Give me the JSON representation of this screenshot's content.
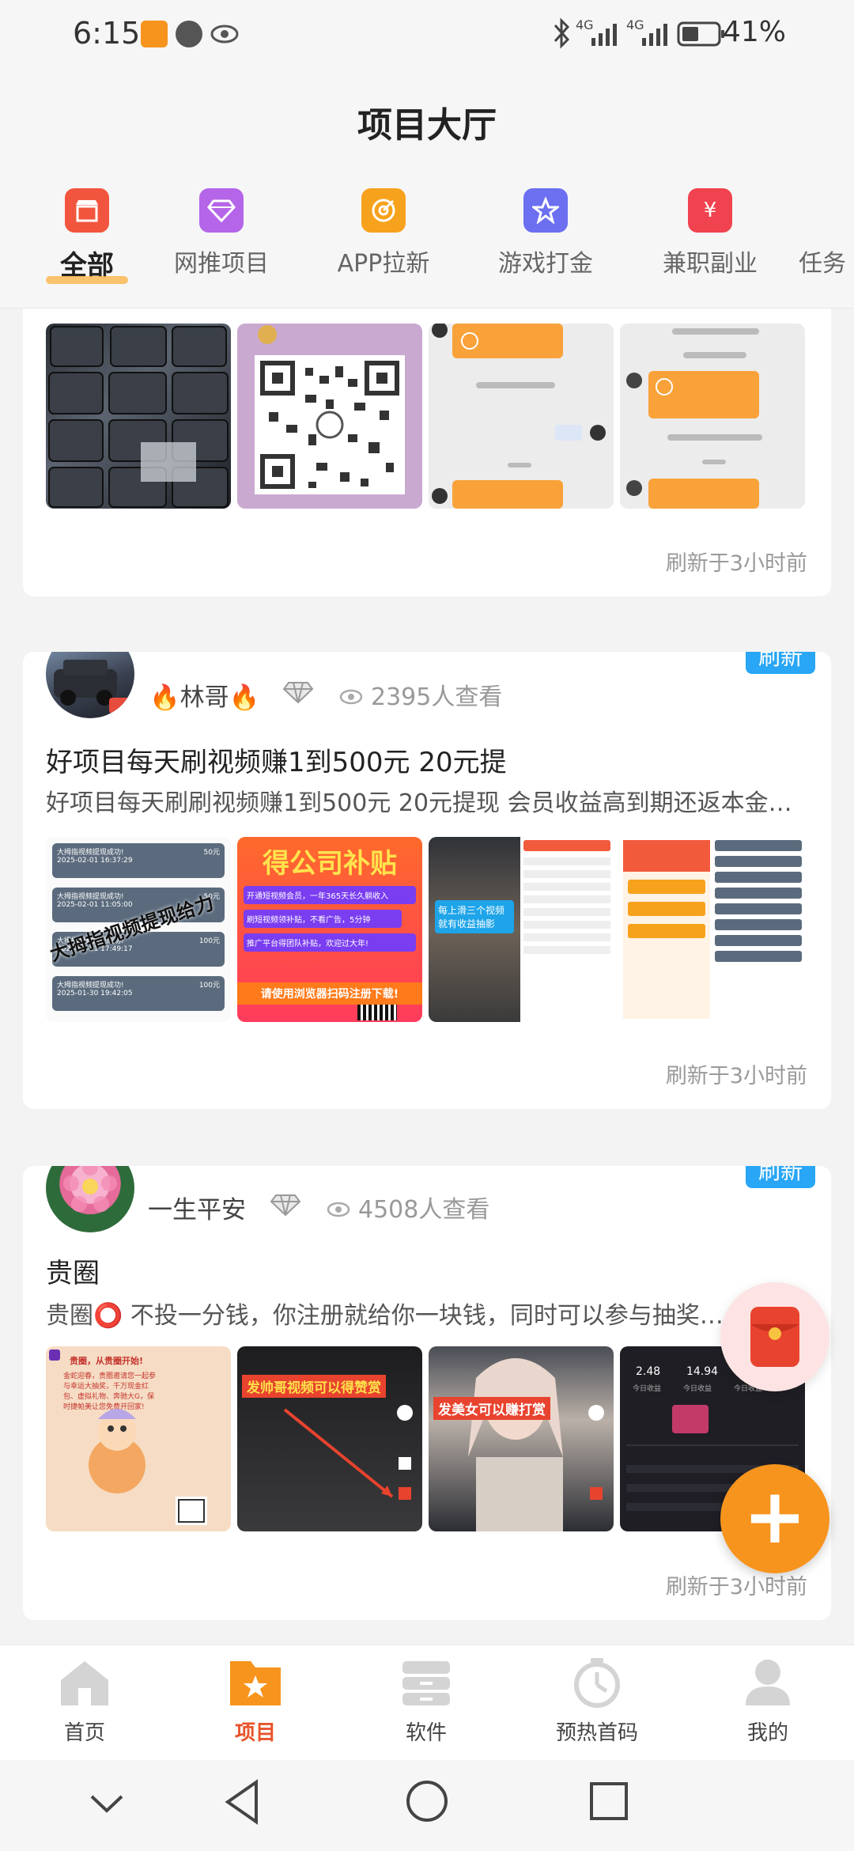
{
  "status_bar": {
    "time": "6:15",
    "network_a": "4G",
    "network_b": "4G",
    "battery": "41%"
  },
  "header": {
    "title": "项目大厅"
  },
  "categories": [
    {
      "label": "全部",
      "icon": "store-icon",
      "color": "#f2553d"
    },
    {
      "label": "网推项目",
      "icon": "diamond-icon",
      "color": "#b565e8"
    },
    {
      "label": "APP拉新",
      "icon": "target-icon",
      "color": "#f7a21c"
    },
    {
      "label": "游戏打金",
      "icon": "star-icon",
      "color": "#6b6ff0"
    },
    {
      "label": "兼职副业",
      "icon": "money-bag-icon",
      "color": "#f0434f"
    },
    {
      "label": "任务",
      "icon": "task-icon",
      "color": "#f7a21c"
    }
  ],
  "cards": [
    {
      "refresh_time": "刷新于3小时前"
    },
    {
      "user": "🔥林哥🔥",
      "views": "2395人查看",
      "badge": "刷新",
      "title": "好项目每天刷视频赚1到500元 20元提",
      "desc": "好项目每天刷刷视频赚1到500元 20元提现 会员收益高到期还返本金…",
      "refresh_time": "刷新于3小时前",
      "thumb_texts": {
        "t1_overlay": "大拇指视频提现给力",
        "t1_rows": [
          "大拇指视频提现成功!",
          "50元",
          "2025-02-01 16:37:29",
          "大拇指视频提现成功!",
          "50元",
          "2025-02-01 11:05:00",
          "大拇指视频提现成功!",
          "100元",
          "2025-01-31 17:49:17",
          "大拇指视频提现成功!",
          "100元",
          "2025-01-30 19:42:05"
        ],
        "t2_head": "得公司补贴",
        "t2_lines": [
          "开通短视频会员，一年365天长久躺收入",
          "刷短视频领补贴，不看广告，5分钟",
          "推广平台得团队补贴，欢迎过大年!"
        ],
        "t2_foot": "请使用浏览器扫码注册下载!",
        "t3_text": "每上滑三个视频 就有收益抽影"
      }
    },
    {
      "user": "一生平安",
      "views": "4508人查看",
      "badge": "刷新",
      "title": "贵圈",
      "desc": "贵圈⭕ 不投一分钱，你注册就给你一块钱，同时可以参与抽奖活动",
      "refresh_time": "刷新于3小时前",
      "thumb_texts": {
        "t1_head": "贵圈，从贵圈开始!",
        "t1_body": "金蛇迎春，贵圈邀请您一起参与幸运大抽奖，千万现金红包、虚拟礼物、奔驰大G，保时捷帕美让您免费开回家!",
        "t2_banner": "发帅哥视频可以得赞赏",
        "t3_banner": "发美女可以赚打赏",
        "t4_stats": [
          "2.48",
          "14.94",
          "248"
        ],
        "t4_stat_labels": [
          "今日收益",
          "今日收益",
          "今日收益"
        ]
      }
    }
  ],
  "bottom_nav": [
    {
      "label": "首页",
      "icon": "home-icon"
    },
    {
      "label": "项目",
      "icon": "project-folder-icon"
    },
    {
      "label": "软件",
      "icon": "software-drawer-icon"
    },
    {
      "label": "预热首码",
      "icon": "stopwatch-icon"
    },
    {
      "label": "我的",
      "icon": "profile-icon"
    }
  ],
  "colors": {
    "accent": "#f7941d",
    "active_tab": "#e8532b",
    "badge": "#29a6f5"
  }
}
